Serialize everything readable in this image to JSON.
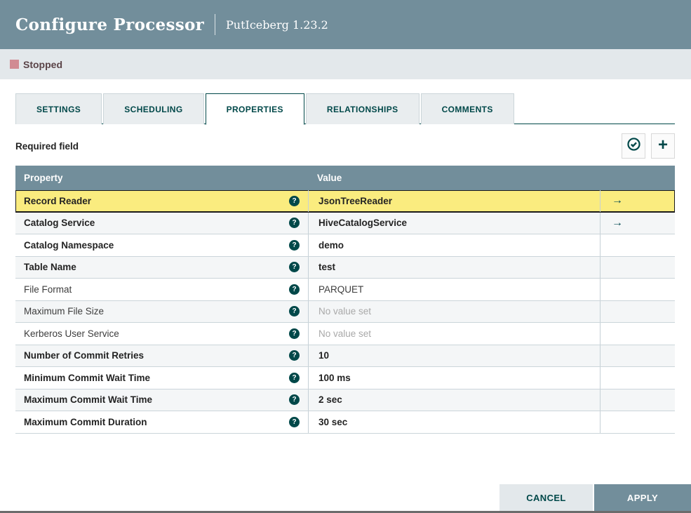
{
  "header": {
    "title": "Configure Processor",
    "subtitle": "PutIceberg 1.23.2"
  },
  "status": {
    "label": "Stopped"
  },
  "tabs": [
    {
      "label": "SETTINGS",
      "active": false
    },
    {
      "label": "SCHEDULING",
      "active": false
    },
    {
      "label": "PROPERTIES",
      "active": true
    },
    {
      "label": "RELATIONSHIPS",
      "active": false
    },
    {
      "label": "COMMENTS",
      "active": false
    }
  ],
  "toolbar": {
    "required_field_label": "Required field",
    "verify_icon": "verify-properties-icon",
    "add_icon": "add-property-icon"
  },
  "table": {
    "columns": [
      "Property",
      "Value"
    ],
    "help_glyph": "?",
    "go_to_glyph": "→",
    "rows": [
      {
        "property": "Record Reader",
        "value": "JsonTreeReader",
        "bold": true,
        "unset": false,
        "selected": true,
        "go_to": true
      },
      {
        "property": "Catalog Service",
        "value": "HiveCatalogService",
        "bold": true,
        "unset": false,
        "selected": false,
        "go_to": true
      },
      {
        "property": "Catalog Namespace",
        "value": "demo",
        "bold": true,
        "unset": false,
        "selected": false,
        "go_to": false
      },
      {
        "property": "Table Name",
        "value": "test",
        "bold": true,
        "unset": false,
        "selected": false,
        "go_to": false
      },
      {
        "property": "File Format",
        "value": "PARQUET",
        "bold": false,
        "unset": false,
        "selected": false,
        "go_to": false
      },
      {
        "property": "Maximum File Size",
        "value": "No value set",
        "bold": false,
        "unset": true,
        "selected": false,
        "go_to": false
      },
      {
        "property": "Kerberos User Service",
        "value": "No value set",
        "bold": false,
        "unset": true,
        "selected": false,
        "go_to": false
      },
      {
        "property": "Number of Commit Retries",
        "value": "10",
        "bold": true,
        "unset": false,
        "selected": false,
        "go_to": false
      },
      {
        "property": "Minimum Commit Wait Time",
        "value": "100 ms",
        "bold": true,
        "unset": false,
        "selected": false,
        "go_to": false
      },
      {
        "property": "Maximum Commit Wait Time",
        "value": "2 sec",
        "bold": true,
        "unset": false,
        "selected": false,
        "go_to": false
      },
      {
        "property": "Maximum Commit Duration",
        "value": "30 sec",
        "bold": true,
        "unset": false,
        "selected": false,
        "go_to": false
      }
    ]
  },
  "footer": {
    "cancel_label": "CANCEL",
    "apply_label": "APPLY"
  },
  "colors": {
    "accent_teal": "#004849",
    "header_slate": "#728E9B",
    "status_bar_bg": "#E3E8EB",
    "stopped_square": "#D18B93",
    "selected_row_yellow": "#FAEC7F",
    "alt_row": "#F4F6F7"
  }
}
